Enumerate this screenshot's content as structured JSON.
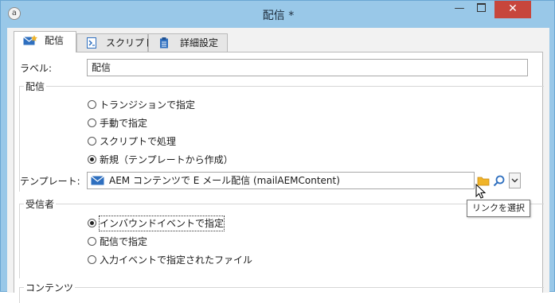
{
  "window": {
    "title": "配信 *",
    "app_icon": "a-icon",
    "controls": {
      "minimize": "—",
      "maximize": "max-icon",
      "close": "✕"
    }
  },
  "tabs": [
    {
      "label": "配信",
      "icon": "envelope-icon",
      "active": true
    },
    {
      "label": "スクリプト",
      "icon": "script-icon",
      "active": false
    },
    {
      "label": "詳細設定",
      "icon": "clipboard-icon",
      "active": false
    }
  ],
  "form": {
    "label_caption": "ラベル:",
    "label_value": "配信"
  },
  "delivery_group": {
    "title": "配信",
    "options": [
      {
        "label": "トランジションで指定",
        "checked": false
      },
      {
        "label": "手動で指定",
        "checked": false
      },
      {
        "label": "スクリプトで処理",
        "checked": false
      },
      {
        "label": "新規（テンプレートから作成）",
        "checked": true
      }
    ],
    "template_caption": "テンプレート:",
    "template_value": "AEM コンテンツで E メール配信 (mailAEMContent)"
  },
  "recipients_group": {
    "title": "受信者",
    "options": [
      {
        "label": "インバウンドイベントで指定",
        "checked": true
      },
      {
        "label": "配信で指定",
        "checked": false
      },
      {
        "label": "入力イベントで指定されたファイル",
        "checked": false
      }
    ]
  },
  "content_group": {
    "title": "コンテンツ"
  },
  "tooltip": {
    "text": "リンクを選択"
  },
  "colors": {
    "titlebar": "#99c8e8",
    "close_button": "#c7463c",
    "envelope_blue": "#2e6fbf",
    "folder_yellow": "#f0b429"
  }
}
